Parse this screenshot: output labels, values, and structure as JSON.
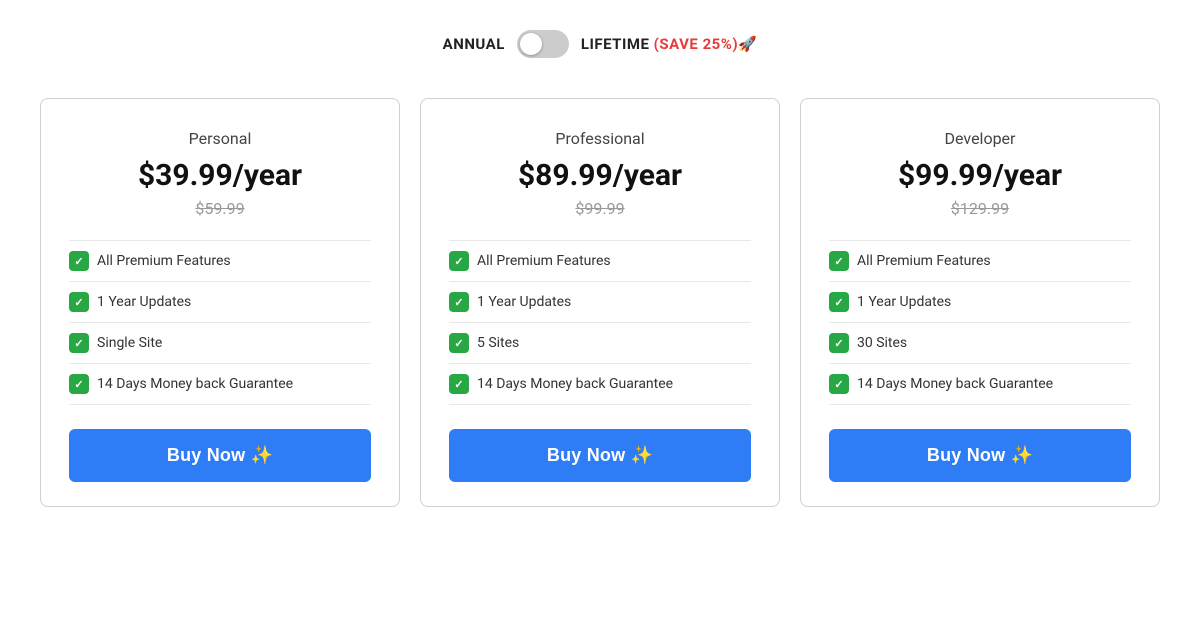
{
  "billing": {
    "annual_label": "ANNUAL",
    "lifetime_label": "LIFETIME",
    "save_badge": "(SAVE 25%)🚀"
  },
  "plans": [
    {
      "id": "personal",
      "name": "Personal",
      "price": "$39.99/year",
      "original_price": "$59.99",
      "features": [
        "✅ All Premium Features",
        "✅ 1 Year Updates",
        "✅ Single Site",
        "✅ 14 Days Money back Guarantee"
      ],
      "button_label": "Buy Now ✨"
    },
    {
      "id": "professional",
      "name": "Professional",
      "price": "$89.99/year",
      "original_price": "$99.99",
      "features": [
        "✅ All Premium Features",
        "✅ 1 Year Updates",
        "✅ 5 Sites",
        "✅ 14 Days Money back Guarantee"
      ],
      "button_label": "Buy Now ✨"
    },
    {
      "id": "developer",
      "name": "Developer",
      "price": "$99.99/year",
      "original_price": "$129.99",
      "features": [
        "✅ All Premium Features",
        "✅ 1 Year Updates",
        "✅ 30 Sites",
        "✅ 14 Days Money back Guarantee"
      ],
      "button_label": "Buy Now ✨"
    }
  ]
}
